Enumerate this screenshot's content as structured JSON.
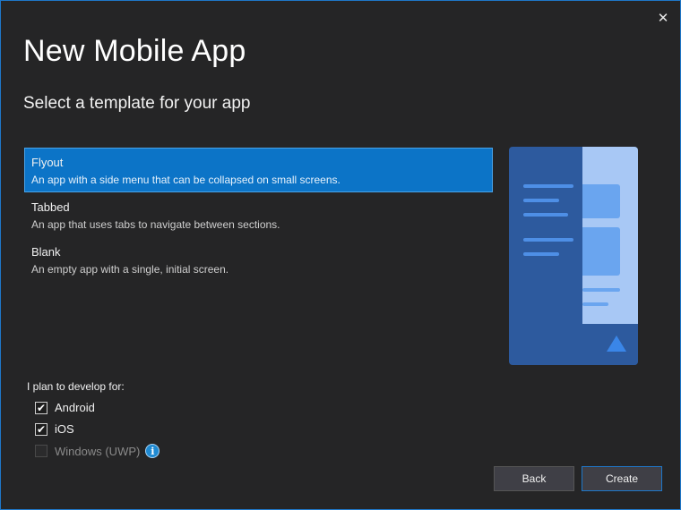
{
  "dialog": {
    "title": "New Mobile App",
    "subtitle": "Select a template for your app",
    "close_icon": "close-icon"
  },
  "templates": [
    {
      "name": "Flyout",
      "description": "An app with a side menu that can be collapsed on small screens.",
      "selected": true
    },
    {
      "name": "Tabbed",
      "description": "An app that uses tabs to navigate between sections.",
      "selected": false
    },
    {
      "name": "Blank",
      "description": "An empty app with a single, initial screen.",
      "selected": false
    }
  ],
  "platforms": {
    "label": "I plan to develop for:",
    "options": [
      {
        "label": "Android",
        "checked": true,
        "enabled": true
      },
      {
        "label": "iOS",
        "checked": true,
        "enabled": true
      },
      {
        "label": "Windows (UWP)",
        "checked": false,
        "enabled": false
      }
    ],
    "info_icon": "info-icon"
  },
  "buttons": {
    "back": "Back",
    "create": "Create"
  },
  "colors": {
    "accent": "#0c74c7",
    "background": "#252526",
    "preview_dark": "#2d5a9e",
    "preview_light": "#a8c8f5"
  }
}
